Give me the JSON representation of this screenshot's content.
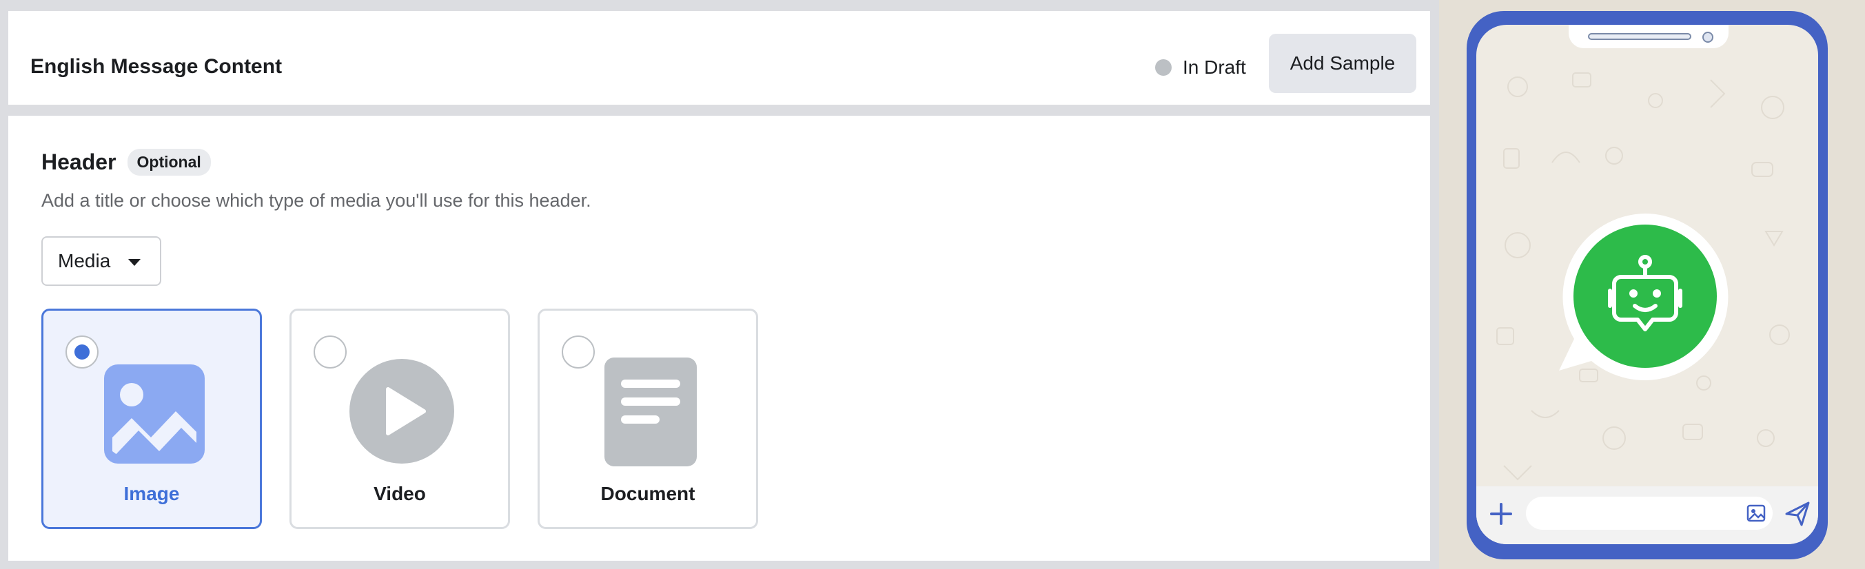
{
  "top": {
    "title": "English Message Content",
    "status": "In Draft",
    "add_sample_label": "Add Sample"
  },
  "header_section": {
    "title": "Header",
    "badge": "Optional",
    "description": "Add a title or choose which type of media you'll use for this header.",
    "dropdown_value": "Media",
    "options": [
      {
        "label": "Image",
        "icon": "image-icon",
        "selected": true
      },
      {
        "label": "Video",
        "icon": "play-icon",
        "selected": false
      },
      {
        "label": "Document",
        "icon": "document-icon",
        "selected": false
      }
    ]
  },
  "preview": {
    "logo": "whatsapp-bot-icon",
    "composer_icons": [
      "plus-icon",
      "attach-image-icon",
      "send-icon"
    ]
  },
  "colors": {
    "accent": "#3e6fd8",
    "phone_frame": "#4462c4",
    "whatsapp_green": "#2dbb4a"
  }
}
